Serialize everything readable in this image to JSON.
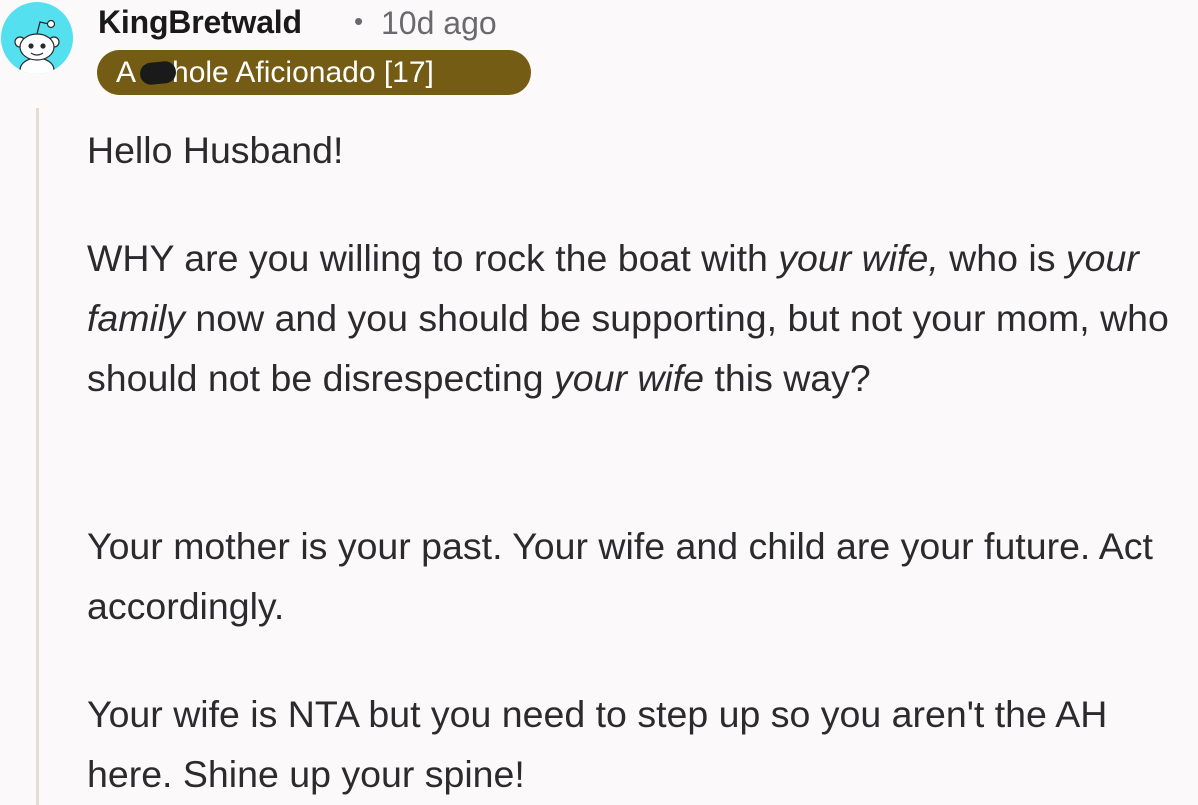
{
  "comment": {
    "author": "KingBretwald",
    "separator": "•",
    "timestamp": "10d ago",
    "flair": "A  hole Aficionado [17]",
    "colors": {
      "avatar_bg": "#54e0ef",
      "flair_bg": "#755c14",
      "flair_text": "#ffffff",
      "thread_line": "#e2ddd6"
    },
    "avatar_icon": "reddit-snoo-icon",
    "paragraphs": {
      "p1": "Hello Husband!",
      "p2": {
        "a": "WHY are you willing to rock the boat with ",
        "b": "your wife,",
        "c": " who is ",
        "d": "your family",
        "e": " now and you should be supporting, but not your mom, who should not be disrespecting ",
        "f": "your wife",
        "g": " this way?"
      },
      "p3": "Your mother is your past. Your wife and child are your future. Act accordingly.",
      "p4": "Your wife is NTA but you need to step up so you aren't the AH here. Shine up your spine!"
    }
  }
}
